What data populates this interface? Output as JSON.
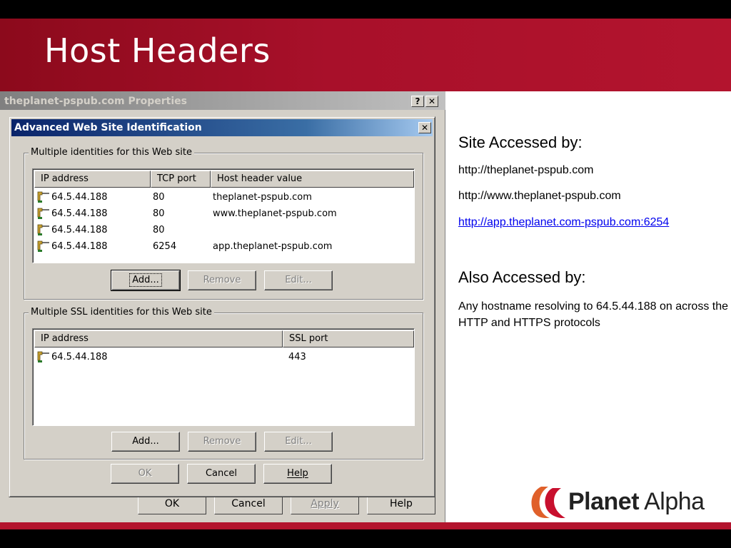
{
  "slide": {
    "title": "Host Headers"
  },
  "properties_window": {
    "title": "theplanet-pspub.com Properties",
    "help_glyph": "?",
    "close_glyph": "✕",
    "buttons": {
      "ok": "OK",
      "cancel": "Cancel",
      "apply": "Apply",
      "help": "Help"
    }
  },
  "advanced_dialog": {
    "title": "Advanced Web Site Identification",
    "close_glyph": "✕",
    "identities_group": {
      "label": "Multiple identities for this Web site",
      "columns": [
        "IP address",
        "TCP port",
        "Host header value"
      ],
      "rows": [
        {
          "ip": "64.5.44.188",
          "port": "80",
          "host": "theplanet-pspub.com"
        },
        {
          "ip": "64.5.44.188",
          "port": "80",
          "host": "www.theplanet-pspub.com"
        },
        {
          "ip": "64.5.44.188",
          "port": "80",
          "host": ""
        },
        {
          "ip": "64.5.44.188",
          "port": "6254",
          "host": "app.theplanet-pspub.com"
        }
      ],
      "buttons": {
        "add": "Add...",
        "remove": "Remove",
        "edit": "Edit..."
      }
    },
    "ssl_group": {
      "label": "Multiple SSL identities for this Web site",
      "columns": [
        "IP address",
        "SSL port"
      ],
      "rows": [
        {
          "ip": "64.5.44.188",
          "port": "443"
        }
      ],
      "buttons": {
        "add": "Add...",
        "remove": "Remove",
        "edit": "Edit..."
      }
    },
    "buttons": {
      "ok": "OK",
      "cancel": "Cancel",
      "help": "Help"
    }
  },
  "right_panel": {
    "site_accessed_heading": "Site Accessed by:",
    "site_urls": [
      "http://theplanet-pspub.com",
      "http://www.theplanet-pspub.com",
      "http://app.theplanet.com-pspub.com:6254"
    ],
    "also_accessed_heading": "Also Accessed by:",
    "also_accessed_text": "Any hostname resolving to 64.5.44.188 on across the HTTP and HTTPS protocols"
  },
  "logo": {
    "bold": "Planet",
    "regular": "Alpha"
  },
  "colors": {
    "header_band": "#b3142e",
    "dialog_title_active": "#0a246a",
    "dialog_title_inactive": "#808080",
    "window_face": "#d4d0c8",
    "link": "#0000ee",
    "logo_orange": "#e0602a",
    "logo_red": "#c8102e"
  },
  "icons": {
    "identity_row": "network-connection-icon"
  }
}
